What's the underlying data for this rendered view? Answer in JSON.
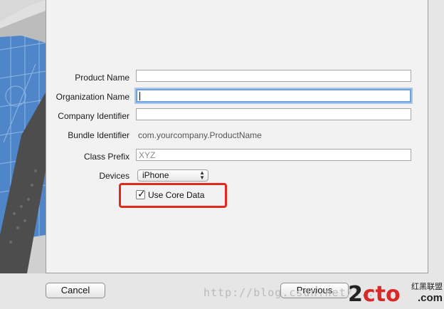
{
  "form": {
    "product_name_label": "Product Name",
    "organization_name_label": "Organization Name",
    "company_identifier_label": "Company Identifier",
    "bundle_identifier_label": "Bundle Identifier",
    "bundle_identifier_value": "com.yourcompany.ProductName",
    "class_prefix_label": "Class Prefix",
    "class_prefix_placeholder": "XYZ",
    "devices_label": "Devices",
    "devices_value": "iPhone",
    "use_core_data_label": "Use Core Data",
    "use_core_data_checked": true
  },
  "buttons": {
    "cancel": "Cancel",
    "previous": "Previous"
  },
  "watermark": "http://blog.csdn.net/l...",
  "logo": {
    "text_a": "2",
    "text_b": "cto",
    "cn": "红黑联盟",
    "com": ".com"
  },
  "colors": {
    "highlight": "#e3281d",
    "focus_ring": "#6fa3e0"
  }
}
